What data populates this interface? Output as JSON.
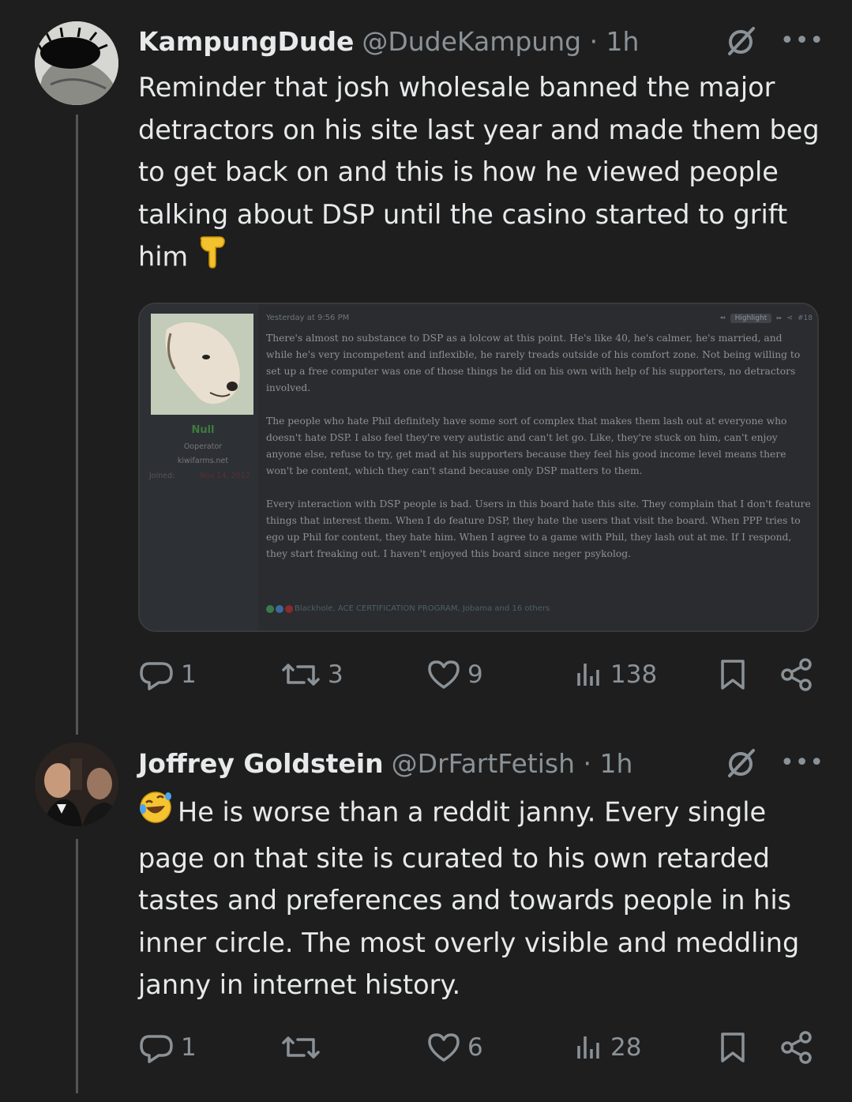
{
  "tweets": [
    {
      "display_name": "KampungDude",
      "handle_time": "@DudeKampung · 1h",
      "text": "Reminder that josh wholesale banned the major detractors on his site last year and made them beg to get back on and this is how he viewed people talking about DSP until the casino started to grift him",
      "emoji": "backhand-index-pointing-down",
      "stats": {
        "replies": "1",
        "reposts": "3",
        "likes": "9",
        "views": "138"
      }
    },
    {
      "display_name": "Joffrey Goldstein",
      "handle_time": "@DrFartFetish · 1h",
      "emoji": "rolling-on-the-floor-laughing",
      "text": "He is worse than a reddit janny. Every single page on that site is curated to his own retarded tastes and preferences and towards people in his inner circle. The most overly visible and meddling janny in internet history.",
      "stats": {
        "replies": "1",
        "reposts": "",
        "likes": "6",
        "views": "28"
      }
    }
  ],
  "embedded_post": {
    "timestamp": "Yesterday at 9:56 PM",
    "highlight_label": "Highlight",
    "post_number": "#18",
    "user": {
      "name": "Null",
      "title": "Ooperator",
      "site": "kiwifarms.net",
      "joined_label": "Joined:",
      "joined_date": "Nov 14, 2012"
    },
    "paragraphs": [
      "There's almost no substance to DSP as a lolcow at this point. He's like 40, he's calmer, he's married, and while he's very incompetent and inflexible, he rarely treads outside of his comfort zone. Not being willing to set up a free computer was one of those things he did on his own with help of his supporters, no detractors involved.",
      "The people who hate Phil definitely have some sort of complex that makes them lash out at everyone who doesn't hate DSP. I also feel they're very autistic and can't let go. Like, they're stuck on him, can't enjoy anyone else, refuse to try, get mad at his supporters because they feel his good income level means there won't be content, which they can't stand because only DSP matters to them.",
      "Every interaction with DSP people is bad. Users in this board hate this site. They complain that I don't feature things that interest them. When I do feature DSP, they hate the users that visit the board. When PPP tries to ego up Phil for content, they hate him. When I agree to a game with Phil, they lash out at me. If I respond, they start freaking out. I haven't enjoyed this board since neger psykolog."
    ],
    "reactions": "Blackhole, ACE CERTIFICATION PROGRAM, Jobama and 16 others"
  },
  "icons": {
    "reply": "speech-bubble-icon",
    "repost": "repost-arrows-icon",
    "like": "heart-icon",
    "views": "bar-chart-icon",
    "bookmark": "bookmark-icon",
    "share": "share-icon",
    "grok": "grok-slash-icon",
    "more": "more-dots-icon"
  },
  "colors": {
    "background": "#1e1e1e",
    "text": "#e7e9ea",
    "muted": "#8b9297",
    "forum_user_green": "#3e7b3e"
  }
}
